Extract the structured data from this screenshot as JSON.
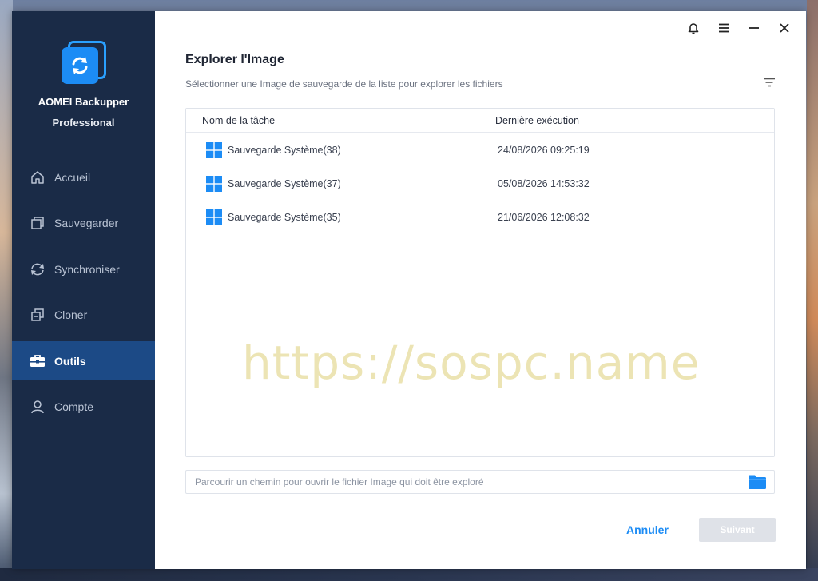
{
  "app": {
    "name": "AOMEI Backupper",
    "edition": "Professional"
  },
  "sidebar": {
    "items": [
      {
        "label": "Accueil",
        "icon": "home-icon",
        "active": false
      },
      {
        "label": "Sauvegarder",
        "icon": "backup-icon",
        "active": false
      },
      {
        "label": "Synchroniser",
        "icon": "sync-icon",
        "active": false
      },
      {
        "label": "Cloner",
        "icon": "clone-icon",
        "active": false
      },
      {
        "label": "Outils",
        "icon": "toolbox-icon",
        "active": true
      },
      {
        "label": "Compte",
        "icon": "user-icon",
        "active": false
      }
    ]
  },
  "titlebar": {
    "icons": [
      "bell-icon",
      "menu-icon",
      "minimize-icon",
      "close-icon"
    ]
  },
  "page": {
    "title": "Explorer l'Image",
    "subtitle": "Sélectionner une Image de sauvegarde de la liste pour explorer les fichiers"
  },
  "table": {
    "col_name": "Nom de la tâche",
    "col_date": "Dernière exécution",
    "rows": [
      {
        "name": "Sauvegarde Système(38)",
        "date": "24/08/2026 09:25:19",
        "icon": "windows-icon"
      },
      {
        "name": "Sauvegarde Système(37)",
        "date": "05/08/2026 14:53:32",
        "icon": "windows-icon"
      },
      {
        "name": "Sauvegarde Système(35)",
        "date": "21/06/2026 12:08:32",
        "icon": "windows-icon"
      }
    ]
  },
  "watermark": "https://sospc.name",
  "path_input": {
    "value": "",
    "placeholder": "Parcourir un chemin pour ouvrir le fichier Image qui doit être exploré"
  },
  "buttons": {
    "cancel": "Annuler",
    "next": "Suivant"
  },
  "colors": {
    "sidebar_bg": "#1a2b47",
    "sidebar_active": "#1c4a86",
    "accent": "#1c8cf5",
    "disabled_button": "#dfe2e8"
  }
}
